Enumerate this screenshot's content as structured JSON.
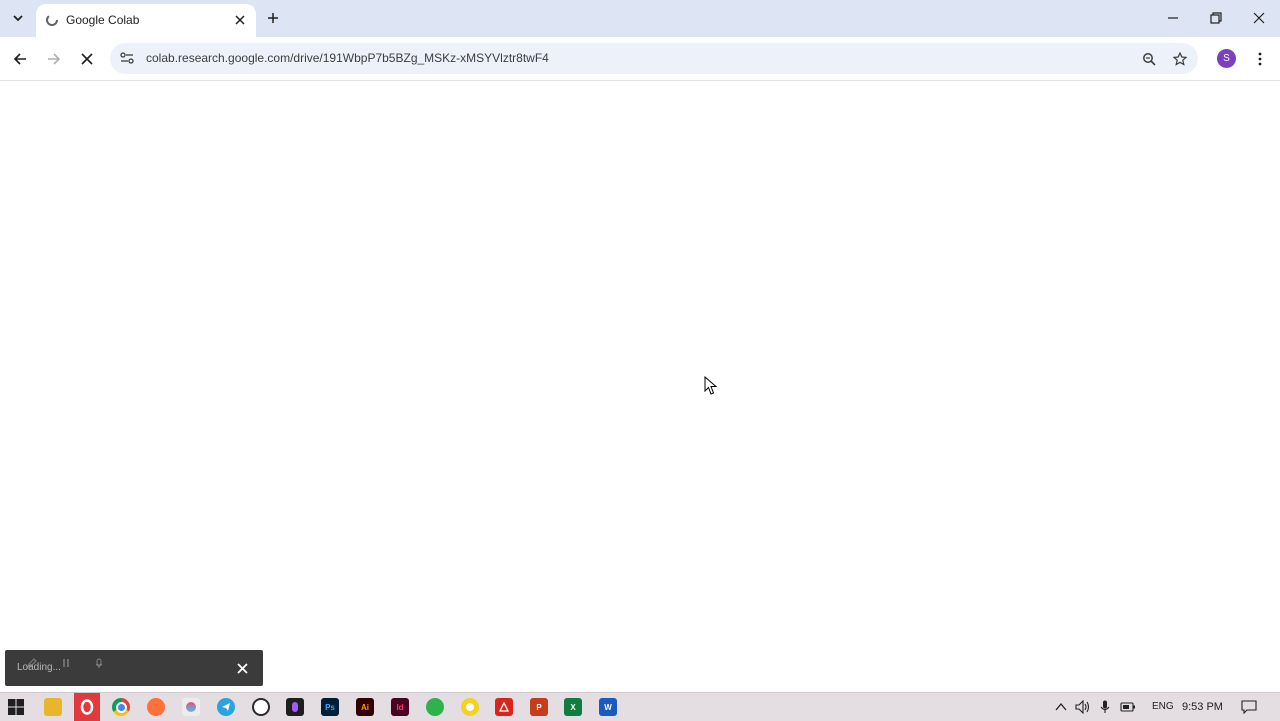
{
  "tab": {
    "title": "Google Colab"
  },
  "address_bar": {
    "url": "colab.research.google.com/drive/191WbpP7b5BZg_MSKz-xMSYVlztr8twF4"
  },
  "profile": {
    "initial": "S"
  },
  "toast": {
    "text": "Loading..."
  },
  "taskbar": {
    "apps": [
      {
        "name": "file-explorer",
        "label": ""
      },
      {
        "name": "opera",
        "label": ""
      },
      {
        "name": "chrome",
        "label": ""
      },
      {
        "name": "firefox",
        "label": ""
      },
      {
        "name": "app",
        "label": ""
      },
      {
        "name": "telegram",
        "label": ""
      },
      {
        "name": "whatsapp",
        "label": ""
      },
      {
        "name": "figma",
        "label": ""
      },
      {
        "name": "photoshop",
        "label": "Ps"
      },
      {
        "name": "illustrator",
        "label": "Ai"
      },
      {
        "name": "indesign",
        "label": "Id"
      },
      {
        "name": "app-green",
        "label": ""
      },
      {
        "name": "app-yellow",
        "label": ""
      },
      {
        "name": "acrobat",
        "label": ""
      },
      {
        "name": "powerpoint",
        "label": "P"
      },
      {
        "name": "excel",
        "label": "X"
      },
      {
        "name": "word",
        "label": "W"
      }
    ],
    "language": "ENG",
    "clock": "9:53 PM"
  },
  "colors": {
    "tabstrip_bg": "#dde4f4",
    "omnibox_bg": "#edf2fa",
    "avatar": "#7b3fbf",
    "taskbar_bg": "#e4dde2"
  }
}
